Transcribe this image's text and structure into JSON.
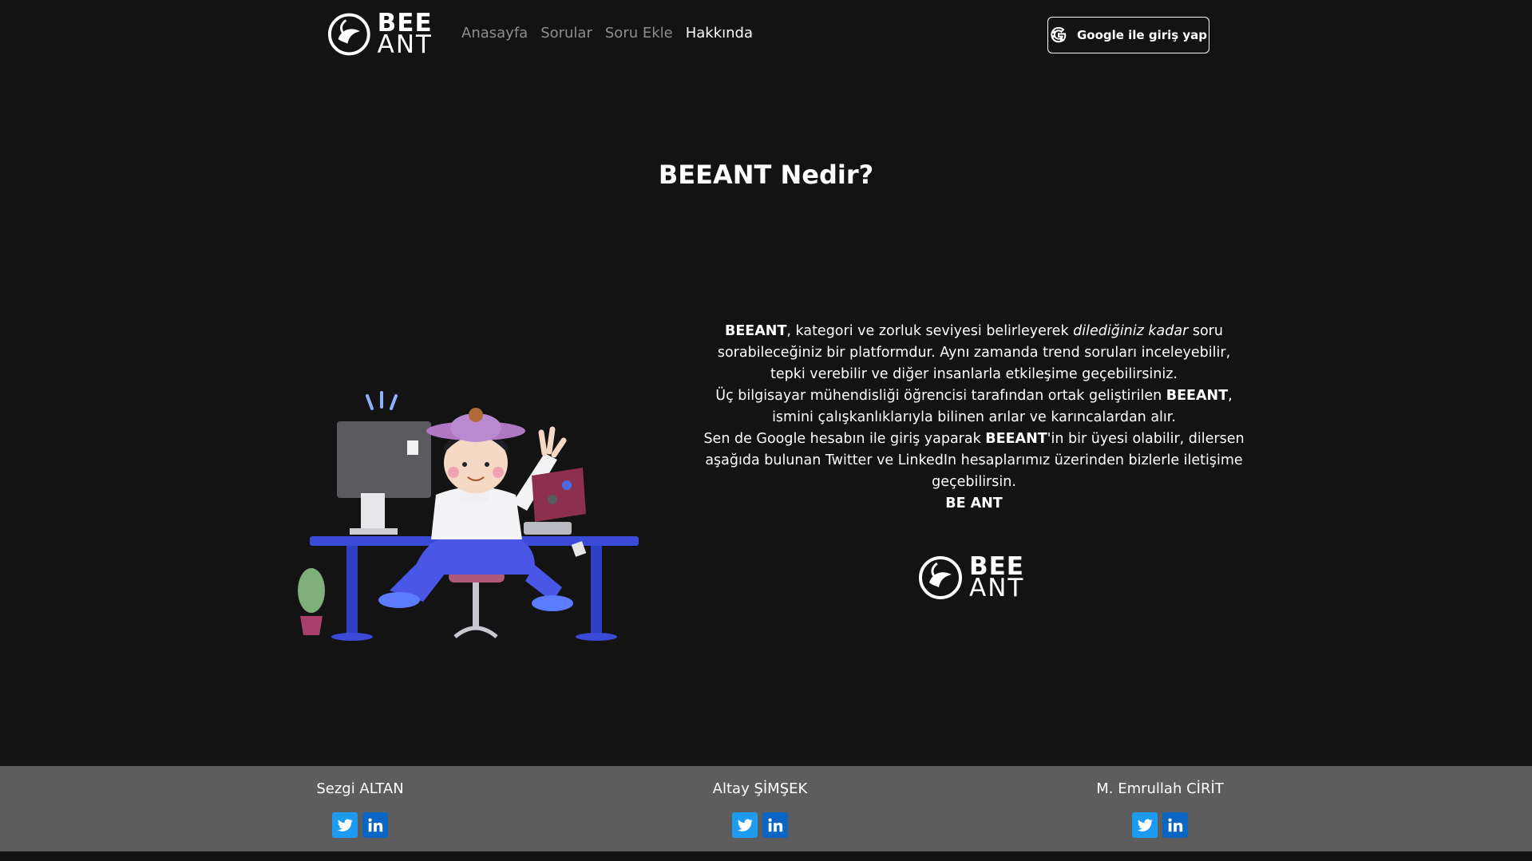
{
  "header": {
    "logo": {
      "line1": "BEE",
      "line2": "ANT"
    },
    "nav": [
      {
        "label": "Anasayfa"
      },
      {
        "label": "Sorular"
      },
      {
        "label": "Soru Ekle"
      },
      {
        "label": "Hakkında"
      }
    ],
    "active_nav": "Hakkında",
    "login_label": "Google ile giriş yap",
    "login_icon": "google-icon"
  },
  "main": {
    "title": "BEEANT Nedir?",
    "about": {
      "brand": "BEEANT",
      "p1_a": ", kategori ve zorluk seviyesi belirleyerek ",
      "p1_em": "dilediğiniz kadar",
      "p1_b": " soru sorabileceğiniz bir platformdur. Aynı zamanda trend soruları inceleyebilir, tepki verebilir ve diğer insanlarla etkileşime geçebilirsiniz.",
      "p2_a": "Üç bilgisayar mühendisliği öğrencisi tarafından ortak geliştirilen ",
      "p2_b": ", ismini çalışkanlıklarıyla bilinen arılar ve karıncalardan alır.",
      "p3_a": "Sen de Google hesabın ile giriş yaparak ",
      "p3_b": "'in bir üyesi olabilir, dilersen aşağıda bulunan Twitter ve LinkedIn hesaplarımız üzerinden bizlerle iletişime geçebilirsin.",
      "sign": "BE ANT"
    },
    "logo": {
      "line1": "BEE",
      "line2": "ANT"
    }
  },
  "footer": {
    "members": [
      {
        "name": "Sezgi ALTAN"
      },
      {
        "name": "Altay ŞİMŞEK"
      },
      {
        "name": "M. Emrullah CİRİT"
      }
    ],
    "icons": [
      "twitter-icon",
      "linkedin-icon"
    ]
  },
  "colors": {
    "background": "#131314",
    "footer": "#5d5d5e",
    "twitter": "#1d9bf0",
    "linkedin": "#0a66c2",
    "desk": "#3a4bd8"
  }
}
